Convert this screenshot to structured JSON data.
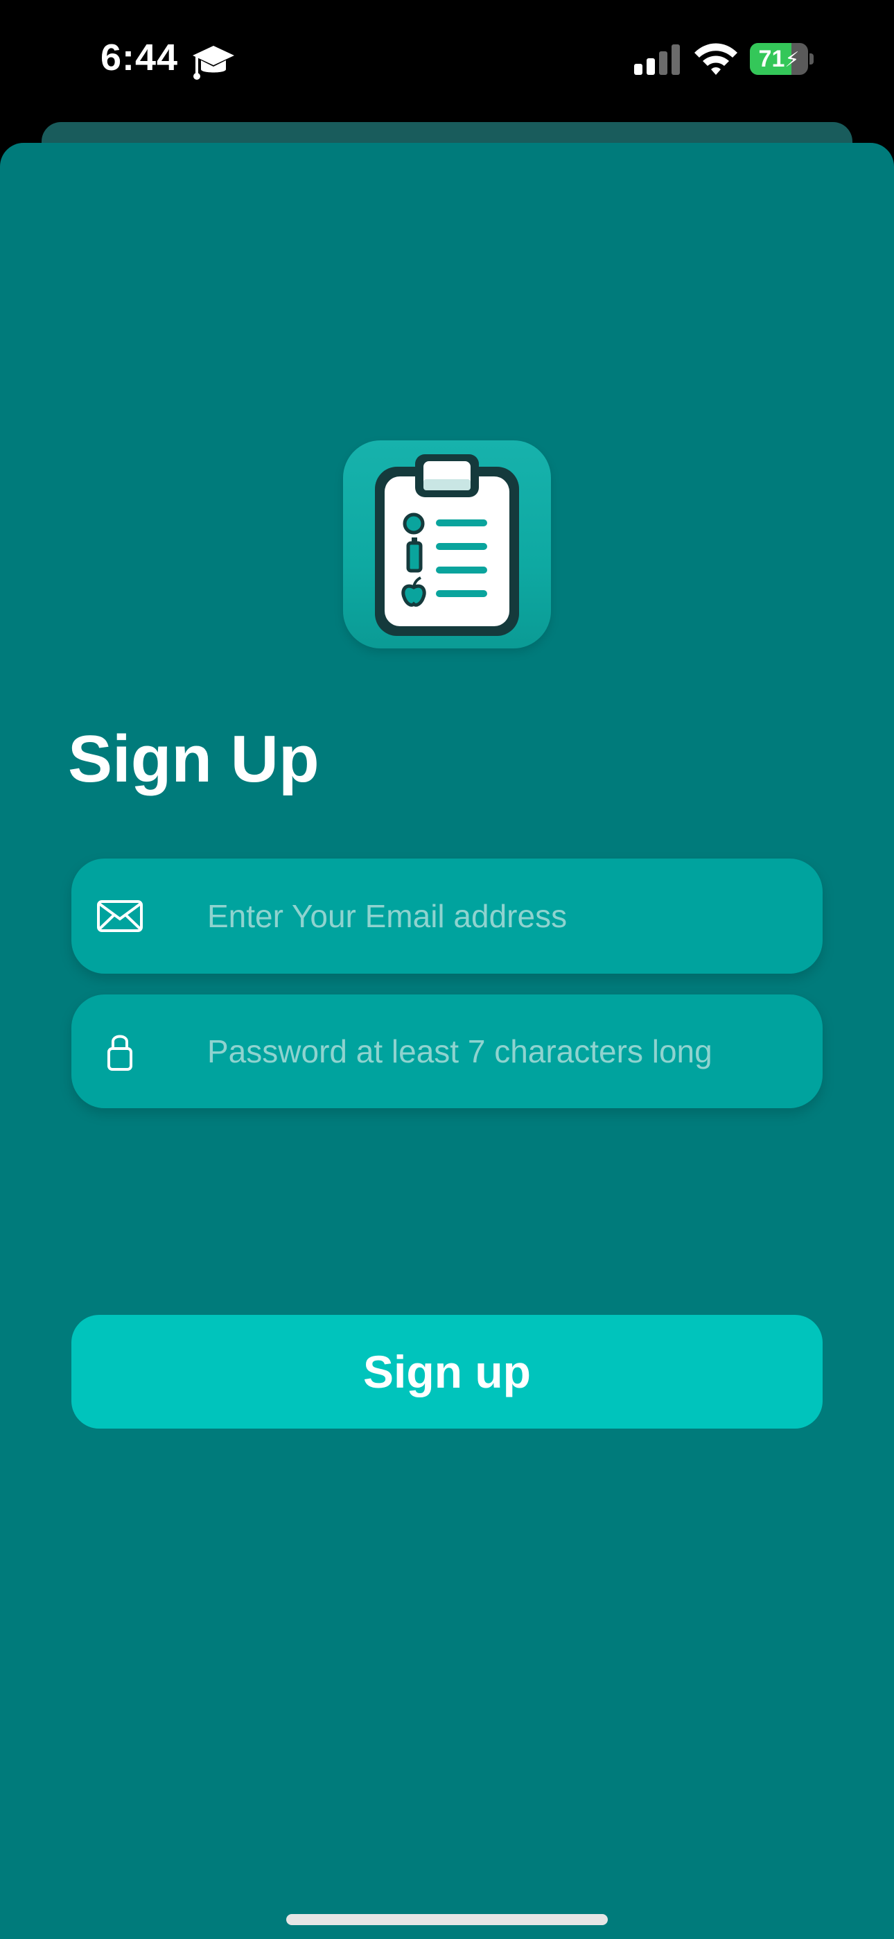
{
  "status_bar": {
    "time": "6:44",
    "battery_level": 71,
    "battery_label": "71",
    "battery_charging": true,
    "icons": [
      "graduation-cap-icon",
      "cellular-signal-icon",
      "wifi-icon",
      "battery-icon"
    ]
  },
  "app_icon": {
    "icon": "clipboard-checklist-icon"
  },
  "signup": {
    "title": "Sign Up",
    "email_placeholder": "Enter Your Email address",
    "email_value": "",
    "email_icon": "envelope-icon",
    "password_placeholder": "Password at least 7 characters long",
    "password_value": "",
    "password_icon": "lock-icon",
    "submit_label": "Sign up"
  },
  "colors": {
    "background": "#007b7b",
    "field_background": "#00a39e",
    "button_background": "#00c4bc",
    "placeholder": "#8fd3cf",
    "text": "#ffffff",
    "battery_green": "#34c759"
  }
}
